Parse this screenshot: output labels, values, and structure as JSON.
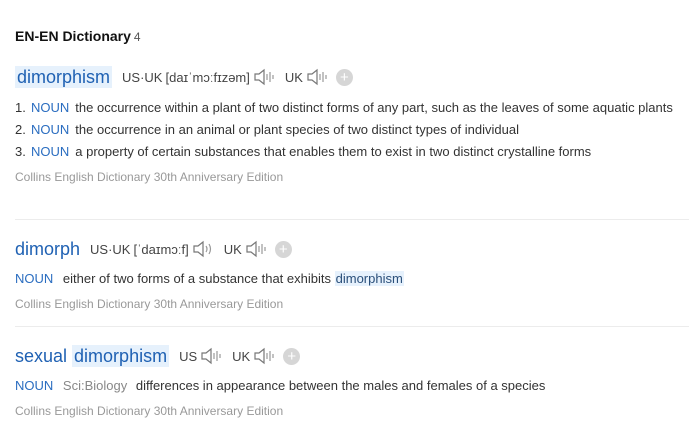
{
  "dictionary": {
    "title": "EN-EN Dictionary",
    "count": "4"
  },
  "entries": [
    {
      "headword": "dimorphism",
      "us_label": "US·UK",
      "pron_us": "[daɪˈmɔːfɪzəm]",
      "uk_label": "UK",
      "senses": [
        {
          "num": "1.",
          "pos": "NOUN",
          "def": "the occurrence within a plant of two distinct forms of any part, such as the leaves of some aquatic plants"
        },
        {
          "num": "2.",
          "pos": "NOUN",
          "def": "the occurrence in an animal or plant species of two distinct types of individual"
        },
        {
          "num": "3.",
          "pos": "NOUN",
          "def": "a property of certain substances that enables them to exist in two distinct crystalline forms"
        }
      ],
      "source": "Collins English Dictionary 30th Anniversary Edition"
    },
    {
      "headword": "dimorph",
      "us_label": "US·UK",
      "pron_us": "[ˈdaɪmɔːf]",
      "uk_label": "UK",
      "pos": "NOUN",
      "def_before": "either of two forms of a substance that exhibits",
      "def_highlight": "dimorphism",
      "source": "Collins English Dictionary 30th Anniversary Edition"
    },
    {
      "headword_plain": "sexual",
      "headword_highlight": "dimorphism",
      "us_label": "US",
      "uk_label": "UK",
      "pos": "NOUN",
      "subject": "Sci:Biology",
      "def": "differences in appearance between the males and females of a species",
      "source": "Collins English Dictionary 30th Anniversary Edition"
    }
  ],
  "icons": {
    "speaker": "speaker-icon",
    "add": "add-icon"
  },
  "colors": {
    "headword": "#1f61b3",
    "pos": "#2a6dc0",
    "highlight_bg": "#e6f1fc",
    "source": "#999999"
  }
}
